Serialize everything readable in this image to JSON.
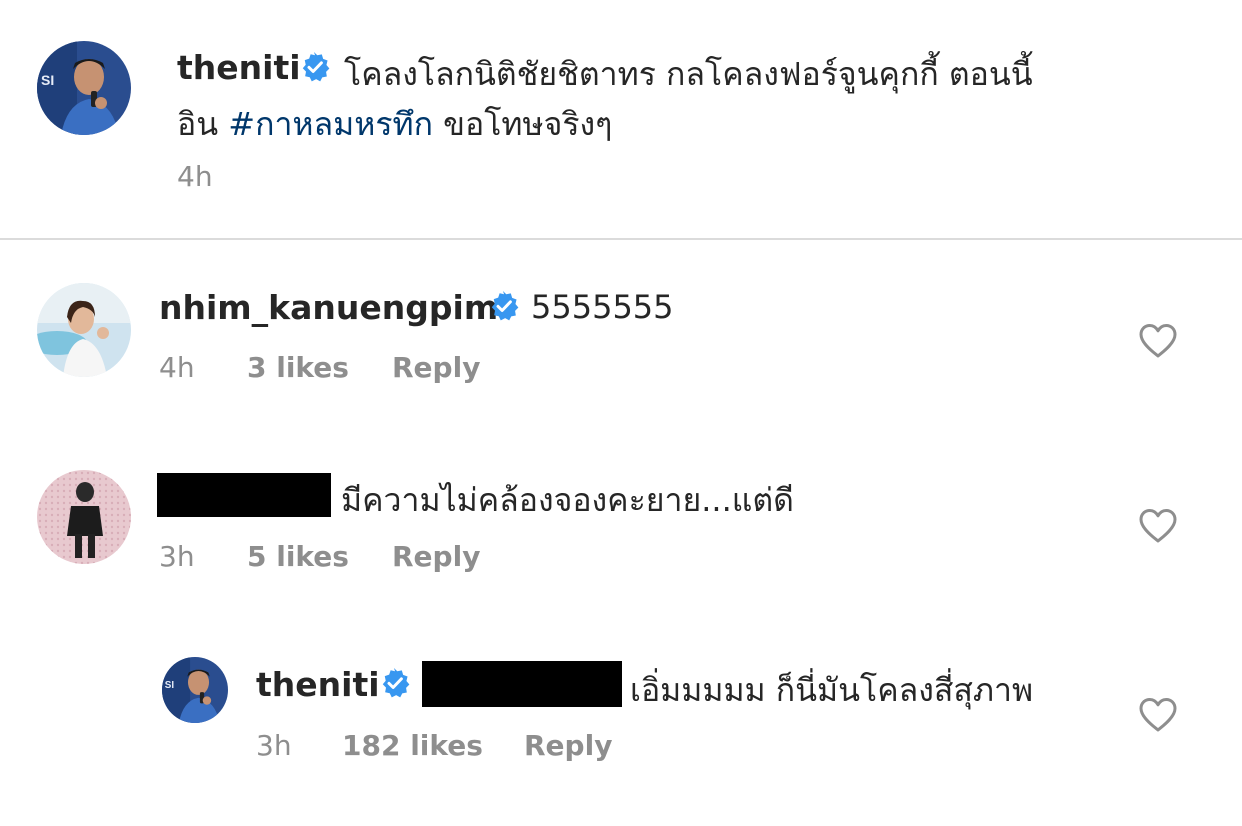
{
  "caption": {
    "username": "theniti",
    "line1": "โคลงโลกนิติชัยชิตาทร กลโคลงฟอร์จูนคุกกี้ ตอนนี้",
    "line2_prefix": "อิน",
    "hashtag": "#กาหลมหรทึก",
    "line2_suffix": "ขอโทษจริงๆ",
    "time": "4h"
  },
  "comments": [
    {
      "username": "nhim_kanuengpim",
      "verified": true,
      "text": "5555555",
      "time": "4h",
      "likes": "3 likes",
      "reply_label": "Reply"
    },
    {
      "username": "",
      "redacted": true,
      "text": "มีความไม่คล้องจองคะยาย...แต่ดี",
      "time": "3h",
      "likes": "5 likes",
      "reply_label": "Reply"
    },
    {
      "username": "theniti",
      "verified": true,
      "is_reply": true,
      "text": "เอิ่มมมมม ก็นี่มันโคลงสี่สุภาพ",
      "time": "3h",
      "likes": "182 likes",
      "reply_label": "Reply"
    }
  ],
  "colors": {
    "text": "#262626",
    "meta": "#8e8e8e",
    "verified": "#3897f0",
    "hashtag": "#00376b",
    "divider": "#dbdbdb"
  },
  "icons": {
    "verified": "verified-badge-icon",
    "like": "heart-outline-icon"
  }
}
